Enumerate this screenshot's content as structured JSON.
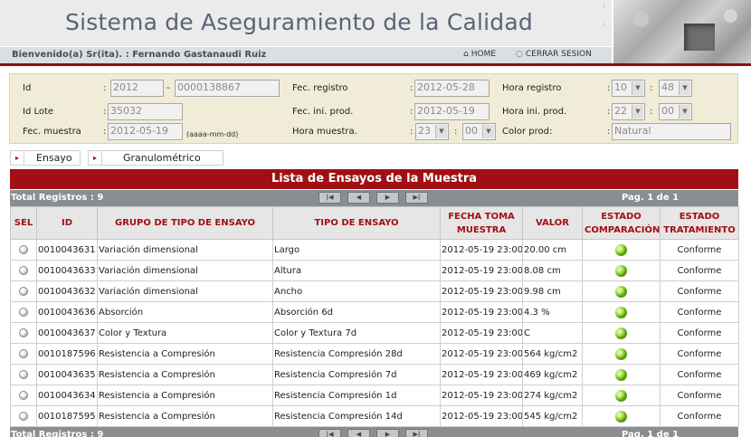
{
  "header": {
    "title": "Sistema de Aseguramiento de la Calidad",
    "welcome": "Bienvenido(a) Sr(ita). : Fernando Gastanaudi Ruiz",
    "home_label": "HOME",
    "logout_label": "CERRAR SESION",
    "home_icon": "home-icon",
    "logout_icon": "power-icon",
    "accent_color": "#8d0d11"
  },
  "form": {
    "id_label": "Id",
    "id_year": "2012",
    "id_number": "0000138867",
    "lote_label": "Id Lote",
    "lote_value": "35032",
    "fec_muestra_label": "Fec. muestra",
    "fec_muestra_value": "2012-05-19",
    "date_hint": "(aaaa-mm-dd)",
    "fec_registro_label": "Fec. registro",
    "fec_registro_value": "2012-05-28",
    "fec_ini_prod_label": "Fec. ini. prod.",
    "fec_ini_prod_value": "2012-05-19",
    "hora_muestra_label": "Hora muestra.",
    "hora_muestra_h": "23",
    "hora_muestra_m": "00",
    "hora_registro_label": "Hora registro",
    "hora_registro_h": "10",
    "hora_registro_m": "48",
    "hora_ini_prod_label": "Hora ini. prod.",
    "hora_ini_prod_h": "22",
    "hora_ini_prod_m": "00",
    "color_prod_label": "Color prod:",
    "color_prod_value": "Natural",
    "colon": ":"
  },
  "tabs": [
    {
      "label": "Ensayo"
    },
    {
      "label": "Granulométrico"
    }
  ],
  "list": {
    "title": "Lista de Ensayos de la Muestra",
    "total": "Total Registros : 9",
    "page": "Pag. 1 de 1",
    "columns": [
      "SEL",
      "ID",
      "GRUPO DE TIPO DE ENSAYO",
      "TIPO DE ENSAYO",
      "FECHA TOMA MUESTRA",
      "VALOR",
      "ESTADO COMPARACIÓN",
      "ESTADO TRATAMIENTO"
    ],
    "status_color": "#7cc61f",
    "rows": [
      {
        "id": "0010043631",
        "grupo": "Variación dimensional",
        "tipo": "Largo",
        "fecha": "2012-05-19 23:00",
        "valor": "20.00 cm",
        "tratamiento": "Conforme"
      },
      {
        "id": "0010043633",
        "grupo": "Variación dimensional",
        "tipo": "Altura",
        "fecha": "2012-05-19 23:00",
        "valor": "8.08 cm",
        "tratamiento": "Conforme"
      },
      {
        "id": "0010043632",
        "grupo": "Variación dimensional",
        "tipo": "Ancho",
        "fecha": "2012-05-19 23:00",
        "valor": "9.98 cm",
        "tratamiento": "Conforme"
      },
      {
        "id": "0010043636",
        "grupo": "Absorción",
        "tipo": "Absorción 6d",
        "fecha": "2012-05-19 23:00",
        "valor": "4.3 %",
        "tratamiento": "Conforme"
      },
      {
        "id": "0010043637",
        "grupo": "Color y Textura",
        "tipo": "Color y Textura 7d",
        "fecha": "2012-05-19 23:00",
        "valor": "C",
        "tratamiento": "Conforme"
      },
      {
        "id": "0010187596",
        "grupo": "Resistencia a Compresión",
        "tipo": "Resistencia Compresión 28d",
        "fecha": "2012-05-19 23:00",
        "valor": "564 kg/cm2",
        "tratamiento": "Conforme"
      },
      {
        "id": "0010043635",
        "grupo": "Resistencia a Compresión",
        "tipo": "Resistencia Compresión 7d",
        "fecha": "2012-05-19 23:00",
        "valor": "469 kg/cm2",
        "tratamiento": "Conforme"
      },
      {
        "id": "0010043634",
        "grupo": "Resistencia a Compresión",
        "tipo": "Resistencia Compresión 1d",
        "fecha": "2012-05-19 23:00",
        "valor": "274 kg/cm2",
        "tratamiento": "Conforme"
      },
      {
        "id": "0010187595",
        "grupo": "Resistencia a Compresión",
        "tipo": "Resistencia Compresión 14d",
        "fecha": "2012-05-19 23:00",
        "valor": "545 kg/cm2",
        "tratamiento": "Conforme"
      }
    ]
  }
}
